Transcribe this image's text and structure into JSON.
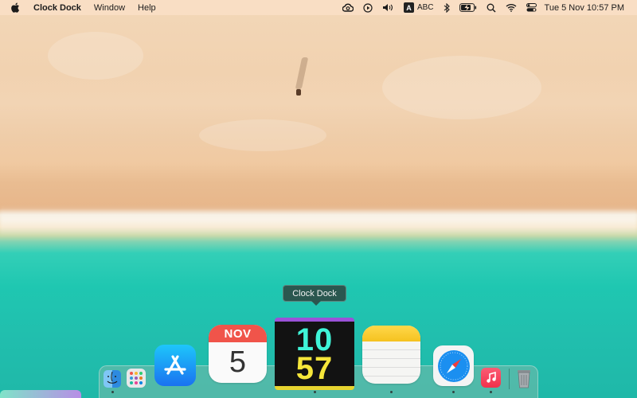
{
  "menubar": {
    "app_name": "Clock Dock",
    "menus": [
      "Window",
      "Help"
    ],
    "input_source_badge": "A",
    "input_source_label": "ABC",
    "datetime": "Tue 5 Nov  10:57 PM",
    "status_icons": [
      "creative-cloud-icon",
      "play-circle-icon",
      "volume-icon",
      "input-source-icon",
      "bluetooth-icon",
      "battery-icon",
      "search-icon",
      "wifi-icon",
      "control-center-icon"
    ]
  },
  "tooltip": {
    "text": "Clock Dock"
  },
  "dock": {
    "calendar": {
      "month": "NOV",
      "day": "5"
    },
    "clock": {
      "hours": "10",
      "minutes": "57"
    },
    "apps": [
      "Finder",
      "Launchpad",
      "App Store",
      "Calendar",
      "Clock Dock",
      "Notes",
      "Safari",
      "Music",
      "Trash"
    ]
  },
  "colors": {
    "calendar_header": "#f0544a",
    "clock_hours": "#3ff4d8",
    "clock_minutes": "#f5e63a",
    "clock_top_bar": "#9a52d8",
    "clock_bottom_bar": "#e6d430"
  }
}
